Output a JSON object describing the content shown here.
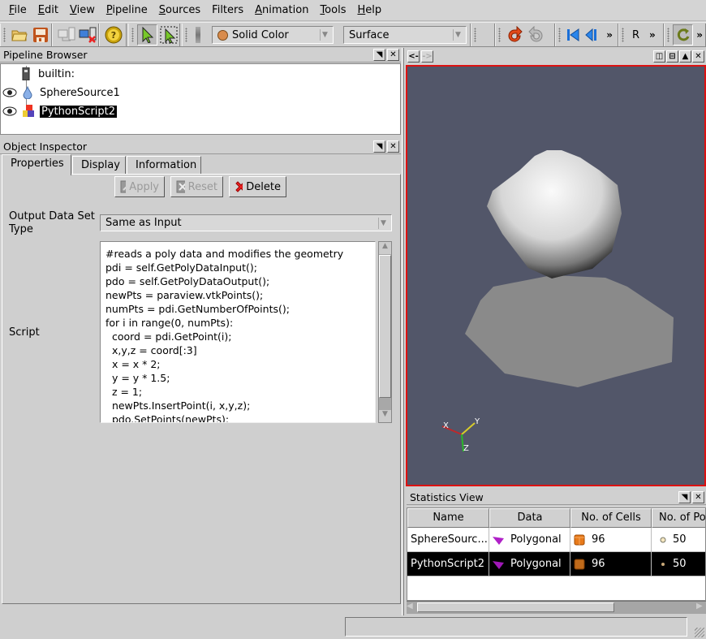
{
  "menubar": {
    "items": [
      {
        "label": "File",
        "mnemonic": "F",
        "rest": "ile"
      },
      {
        "label": "Edit",
        "mnemonic": "E",
        "rest": "dit"
      },
      {
        "label": "View",
        "mnemonic": "V",
        "rest": "iew"
      },
      {
        "label": "Pipeline",
        "mnemonic": "P",
        "rest": "ipeline"
      },
      {
        "label": "Sources",
        "mnemonic": "S",
        "rest": "ources"
      },
      {
        "label": "Filters",
        "mnemonic": "Fi",
        "rest": "lters"
      },
      {
        "label": "Animation",
        "mnemonic": "A",
        "rest": "nimation"
      },
      {
        "label": "Tools",
        "mnemonic": "T",
        "rest": "ools"
      },
      {
        "label": "Help",
        "mnemonic": "H",
        "rest": "elp"
      }
    ]
  },
  "toolbar": {
    "color_by": "Solid Color",
    "representation": "Surface",
    "more": "»",
    "r_label": "R",
    "icons": [
      "open-folder-icon",
      "save-icon",
      "connect-icon",
      "disconnect-icon",
      "help-icon",
      "select-icon",
      "rubber-band-select-icon",
      "undo-icon",
      "redo-icon",
      "first-frame-icon",
      "previous-frame-icon",
      "reset-camera-icon"
    ]
  },
  "pipeline_browser": {
    "title": "Pipeline Browser",
    "items": [
      {
        "label": "builtin:",
        "icon": "server-icon",
        "visible": null
      },
      {
        "label": "SphereSource1",
        "icon": "sphere-source-icon",
        "visible": true
      },
      {
        "label": "PythonScript2",
        "icon": "python-script-icon",
        "visible": true,
        "selected": true
      }
    ]
  },
  "object_inspector": {
    "title": "Object Inspector",
    "tabs": [
      "Properties",
      "Display",
      "Information"
    ],
    "active_tab": "Properties",
    "buttons": {
      "apply": "Apply",
      "reset": "Reset",
      "delete": "Delete"
    },
    "output_type_label_1": "Output Data Set",
    "output_type_label_2": "Type",
    "output_type_value": "Same as Input",
    "script_label": "Script",
    "script": "#reads a poly data and modifies the geometry\npdi = self.GetPolyDataInput();\npdo = self.GetPolyDataOutput();\nnewPts = paraview.vtkPoints();\nnumPts = pdi.GetNumberOfPoints();\nfor i in range(0, numPts):\n  coord = pdi.GetPoint(i);\n  x,y,z = coord[:3]\n  x = x * 2;\n  y = y * 1.5;\n  z = 1;\n  newPts.InsertPoint(i, x,y,z);\n  pdo.SetPoints(newPts);"
  },
  "view": {
    "back_label": "<-",
    "forward_label": "->",
    "background_color": "#525669",
    "active_border_color": "#dd1111",
    "axes": {
      "x": "X",
      "y": "Y",
      "z": "Z"
    }
  },
  "statistics": {
    "title": "Statistics View",
    "columns": [
      "Name",
      "Data",
      "No. of Cells",
      "No. of Po"
    ],
    "rows": [
      {
        "name": "SphereSourc...",
        "data": "Polygonal",
        "cells": "96",
        "points": "50",
        "selected": false
      },
      {
        "name": "PythonScript2",
        "data": "Polygonal",
        "cells": "96",
        "points": "50",
        "selected": true
      }
    ]
  }
}
